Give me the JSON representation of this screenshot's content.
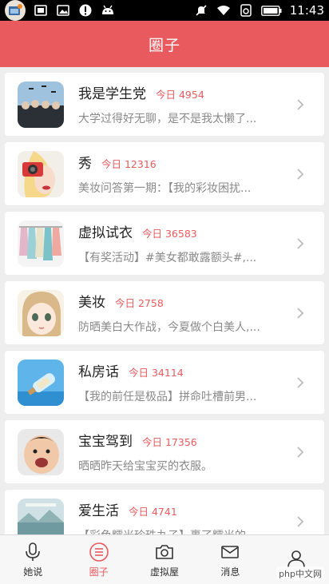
{
  "status_bar": {
    "time": "11:43",
    "icons": [
      "app-notification-icon",
      "gallery-icon",
      "image-icon",
      "alert-icon",
      "android-icon",
      "mute-icon",
      "wifi-icon",
      "sim-icon",
      "battery-icon"
    ]
  },
  "header": {
    "title": "圈子"
  },
  "groups": [
    {
      "title": "我是学生党",
      "today": "今日 4954",
      "desc": "大学过得好无聊，是不是我太懒了...",
      "thumb": "graduation-photo"
    },
    {
      "title": "秀",
      "today": "今日 12316",
      "desc": "美妆问答第一期：【我的彩妆困扰...",
      "thumb": "camera-girl-photo"
    },
    {
      "title": "虚拟试衣",
      "today": "今日 36583",
      "desc": "【有奖活动】#美女都敢露额头#,...",
      "thumb": "clothes-rack-photo"
    },
    {
      "title": "美妆",
      "today": "今日 2758",
      "desc": "防晒美白大作战，今夏做个白美人,...",
      "thumb": "cartoon-girl-illustration"
    },
    {
      "title": "私房话",
      "today": "今日 34114",
      "desc": "【我的前任是极品】拼命吐槽前男...",
      "thumb": "bottle-photo"
    },
    {
      "title": "宝宝驾到",
      "today": "今日 17356",
      "desc": "晒晒昨天给宝宝买的衣服。",
      "thumb": "baby-photo"
    },
    {
      "title": "爱生活",
      "today": "今日 4741",
      "desc": "【彩色糯米珍珠丸子】裹了糯米的...",
      "thumb": "landscape-photo"
    }
  ],
  "bottom_nav": [
    {
      "label": "她说",
      "icon": "microphone-icon",
      "active": false
    },
    {
      "label": "圈子",
      "icon": "list-icon",
      "active": true
    },
    {
      "label": "虚拟屋",
      "icon": "camera-icon",
      "active": false
    },
    {
      "label": "消息",
      "icon": "mail-icon",
      "active": false
    },
    {
      "label": "",
      "icon": "user-icon",
      "active": false
    }
  ],
  "watermark": "php中文网",
  "colors": {
    "accent": "#e95a5e",
    "background": "#eeeeee"
  }
}
